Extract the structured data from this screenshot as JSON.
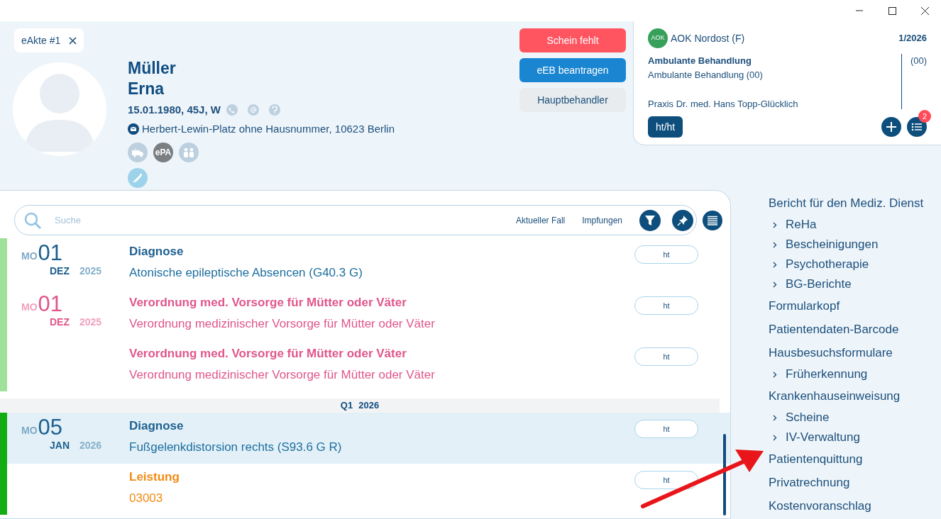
{
  "tab": {
    "label": "eAkte #1"
  },
  "patient": {
    "last_name": "Müller",
    "first_name": "Erna",
    "details": "15.01.1980, 45J, W",
    "address": "Herbert-Lewin-Platz ohne Hausnummer, 10623 Berlin",
    "epa_label": "ePA"
  },
  "actions": [
    {
      "label": "Schein fehlt",
      "kind": "danger"
    },
    {
      "label": "eEB beantragen",
      "kind": "primary"
    },
    {
      "label": "Hauptbehandler",
      "kind": "secondary"
    }
  ],
  "insurance": {
    "logo_text": "AOK",
    "name": "AOK Nordost (F)",
    "quarter": "1/2026",
    "case_title": "Ambulante Behandlung",
    "case_text": "Ambulante Behandlung (00)",
    "code": "(00)",
    "practice": "Praxis Dr. med. Hans Topp-Glücklich",
    "doctor_tag": "ht/ht",
    "badge": "2"
  },
  "search": {
    "placeholder": "Suche",
    "filters": [
      "Aktueller Fall",
      "Impfungen"
    ]
  },
  "timeline": [
    {
      "kind": "entry",
      "color": "#9fe09a",
      "weekday": "MO",
      "day": "01",
      "month": "DEZ",
      "year": "2025",
      "items": [
        {
          "kind": "diagnosis",
          "title": "Diagnose",
          "text": "Atonische epileptische Absencen (G40.3 G)",
          "tag": "ht",
          "selected": false
        }
      ]
    },
    {
      "kind": "entry",
      "color": "#9fe09a",
      "weekday": "MO",
      "day": "01",
      "month": "DEZ",
      "year": "2025",
      "items": [
        {
          "kind": "prescription",
          "title": "Verordnung med. Vorsorge für Mütter oder Väter",
          "text": "Verordnung medizinischer Vorsorge für Mütter oder Väter",
          "tag": "ht",
          "selected": false
        },
        {
          "kind": "prescription",
          "title": "Verordnung med. Vorsorge für Mütter oder Väter",
          "text": "Verordnung medizinischer Vorsorge für Mütter oder Väter",
          "tag": "ht",
          "selected": false
        }
      ]
    },
    {
      "kind": "divider",
      "quarter": "Q1",
      "year": "2026"
    },
    {
      "kind": "entry",
      "color": "#12ad12",
      "weekday": "MO",
      "day": "05",
      "month": "JAN",
      "year": "2026",
      "items": [
        {
          "kind": "diagnosis",
          "title": "Diagnose",
          "text": "Fußgelenkdistorsion rechts (S93.6 G R)",
          "tag": "ht",
          "selected": true
        },
        {
          "kind": "service",
          "title": "Leistung",
          "text": "03003",
          "tag": "ht",
          "selected": false
        }
      ]
    }
  ],
  "menu": [
    {
      "kind": "link",
      "label": "Bericht für den Mediz. Dienst"
    },
    {
      "kind": "group",
      "label": "ReHa"
    },
    {
      "kind": "group",
      "label": "Bescheinigungen"
    },
    {
      "kind": "group",
      "label": "Psychotherapie"
    },
    {
      "kind": "group",
      "label": "BG-Berichte"
    },
    {
      "kind": "link",
      "label": "Formularkopf"
    },
    {
      "kind": "link",
      "label": "Patientendaten-Barcode"
    },
    {
      "kind": "link",
      "label": "Hausbesuchsformulare"
    },
    {
      "kind": "group",
      "label": "Früherkennung"
    },
    {
      "kind": "link",
      "label": "Krankenhauseinweisung"
    },
    {
      "kind": "group",
      "label": "Scheine"
    },
    {
      "kind": "group",
      "label": "IV-Verwaltung"
    },
    {
      "kind": "link",
      "label": "Patientenquittung"
    },
    {
      "kind": "link",
      "label": "Privatrechnung"
    },
    {
      "kind": "link",
      "label": "Kostenvoranschlag"
    }
  ]
}
